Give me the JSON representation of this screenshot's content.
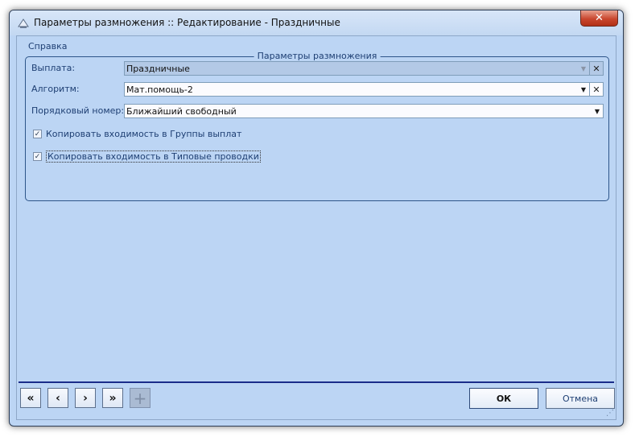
{
  "window": {
    "title": "Параметры размножения :: Редактирование - Праздничные",
    "close_glyph": "✕"
  },
  "menu": {
    "help": "Справка"
  },
  "group": {
    "title": "Параметры размножения",
    "payment": {
      "label": "Выплата:",
      "value": "Праздничные"
    },
    "algorithm": {
      "label": "Алгоритм:",
      "value": "Мат.помощь-2"
    },
    "order": {
      "label": "Порядковый номер:",
      "value": "Ближайший свободный"
    },
    "copy_groups": {
      "label": "Копировать входимость в Группы выплат",
      "checked": true
    },
    "copy_postings": {
      "label": "Копировать входимость в Типовые проводки",
      "checked": true
    }
  },
  "icons": {
    "dropdown": "▼",
    "clear": "✕",
    "check": "✓",
    "first": "«",
    "prev": "‹",
    "next": "›",
    "last": "»",
    "add": "+"
  },
  "buttons": {
    "ok": "ОК",
    "cancel": "Отмена"
  },
  "colors": {
    "window_bg": "#bcd5f4",
    "accent": "#1a2c8a",
    "label": "#1e3f73"
  }
}
